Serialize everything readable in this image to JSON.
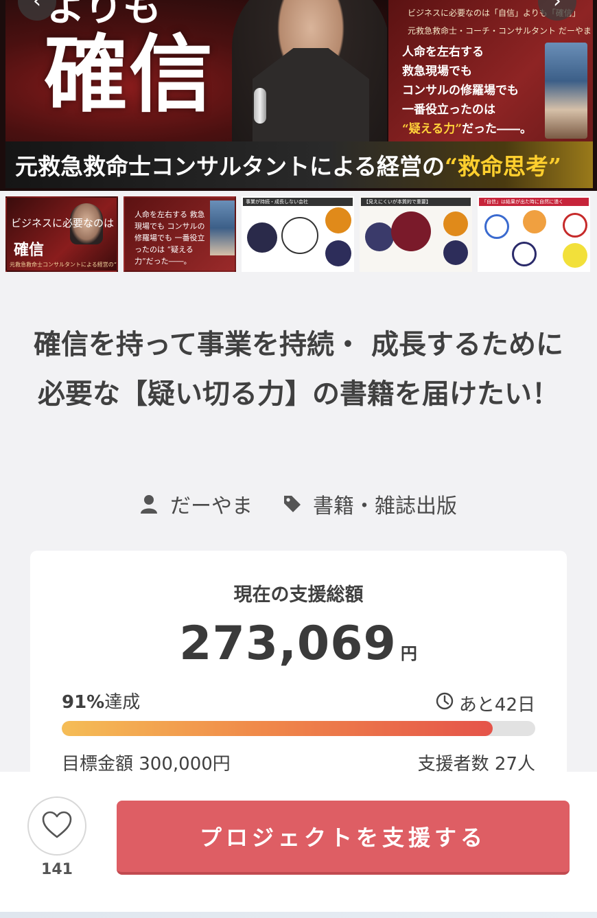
{
  "hero": {
    "top_text": "よりも",
    "big_text": "確信",
    "right_line1": "ビジネスに必要なのは「自信」よりも「確信」",
    "right_line2": "元救急救命士・コーチ・コンサルタント だーやま",
    "right_body_1": "人命を左右する",
    "right_body_2": "救急現場でも",
    "right_body_3": "コンサルの修羅場でも",
    "right_body_4": "一番役立ったのは",
    "right_body_5_highlight": "“疑える力”",
    "right_body_5_rest": "だった――。",
    "banner_text": "元救急救命士コンサルタントによる経営の",
    "banner_highlight": "“救命思考”",
    "prev_glyph": "‹",
    "next_glyph": "›"
  },
  "thumbnails": {
    "t1_a": "ビジネスに必要なのは",
    "t1_b": "確信",
    "t1_c": "元救急救命士コンサルタントによる経営の“救命思考”",
    "t2_a": "人命を左右する 救急現場でも コンサルの修羅場でも 一番役立ったのは “疑える力”だった――。",
    "t3_header": "事業が持続・成長しない会社",
    "t4_header": "【見えにくいが本質的で重要】",
    "t5_header": "「自信」は結果が出た時に自然に湧く"
  },
  "project": {
    "title": "確信を持って事業を持続・ 成長するために必要な【疑い切る力】の書籍を届けたい！",
    "owner": "だーやま",
    "category": "書籍・雑誌出版"
  },
  "funding": {
    "label": "現在の支援総額",
    "amount": "273,069",
    "currency": "円",
    "achieved_percent": "91%",
    "achieved_suffix": "達成",
    "remaining": "あと42日",
    "progress_fraction": 0.91,
    "goal": "目標金額 300,000円",
    "backers": "支援者数 27人"
  },
  "actions": {
    "like_count": "141",
    "support_label": "プロジェクトを支援する"
  },
  "colors": {
    "support_button": "#de5e64",
    "progress_start": "#f5bd56",
    "progress_end": "#e5544a",
    "page_bg": "#f2f2f4"
  },
  "icons": {
    "owner": "user-icon",
    "category": "tag-icon",
    "remaining": "clock-icon",
    "like": "heart-icon"
  }
}
